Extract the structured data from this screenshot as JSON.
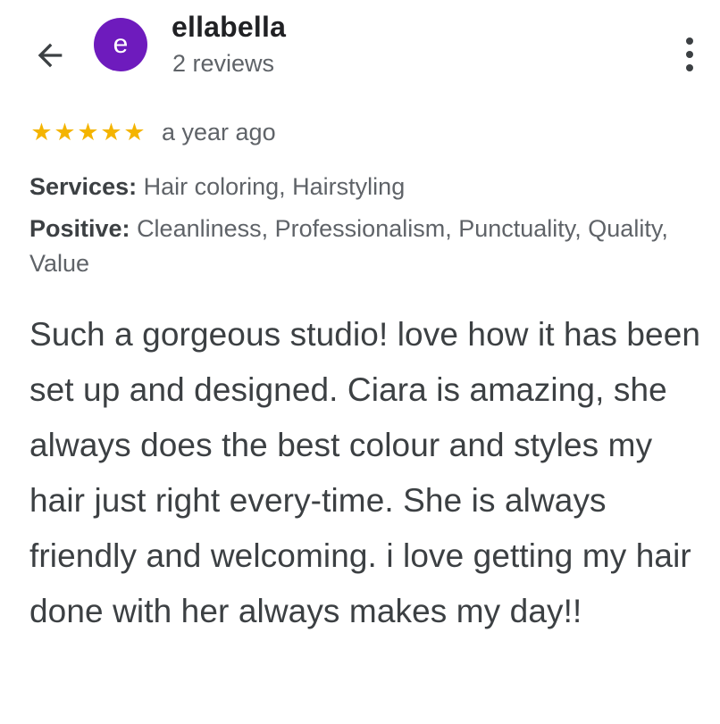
{
  "header": {
    "avatar_letter": "e",
    "avatar_color": "#6e1bbd",
    "user_name": "ellabella",
    "review_count": "2 reviews",
    "back_icon": "arrow-left-icon",
    "menu_icon": "more-vert-icon"
  },
  "rating": {
    "stars": 5,
    "star_glyph": "★",
    "star_color": "#f4b400",
    "time_ago": "a year ago"
  },
  "attributes": {
    "services_label": "Services:",
    "services_value": "Hair coloring, Hairstyling",
    "positive_label": "Positive:",
    "positive_value": "Cleanliness, Professionalism, Punctuality, Quality, Value"
  },
  "review": {
    "text": "Such a gorgeous studio! love how it has been set up and designed. Ciara is amazing, she always does the best colour and styles my hair just right every-time. She is always friendly and welcoming. i love getting my hair done with her always makes my day!!"
  }
}
